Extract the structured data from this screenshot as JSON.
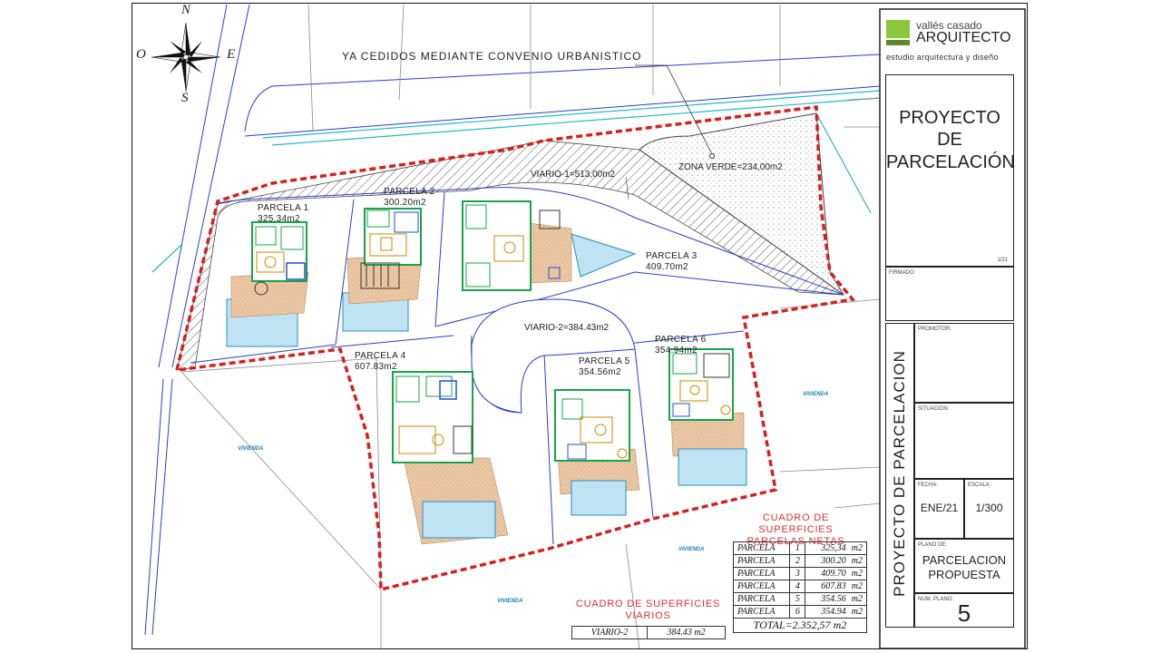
{
  "compass": {
    "n": "N",
    "s": "S",
    "e": "E",
    "o": "O"
  },
  "annotation": "YA CEDIDOS MEDIANTE CONVENIO URBANISTICO",
  "zones": {
    "viario1": "VIARIO-1=513,00m2",
    "viario2": "VIARIO-2=384.43m2",
    "zona_verde": "ZONA VERDE=234,00m2"
  },
  "parcelas": [
    {
      "name": "PARCELA 1",
      "area": "325.34m2"
    },
    {
      "name": "PARCELA 2",
      "area": "300.20m2"
    },
    {
      "name": "PARCELA 3",
      "area": "409.70m2"
    },
    {
      "name": "PARCELA 4",
      "area": "607.83m2"
    },
    {
      "name": "PARCELA 5",
      "area": "354.56m2"
    },
    {
      "name": "PARCELA 6",
      "area": "354.94m2"
    }
  ],
  "vivienda_label": "VIVIENDA",
  "title_block": {
    "brand_line1": "vallés casado",
    "brand_line2": "ARQUITECTO",
    "brand_line3": "estudio arquitectura y diseño",
    "project_title_1": "PROYECTO",
    "project_title_2": "DE",
    "project_title_3": "PARCELACIÓN",
    "date_code": "1/21",
    "firmado_label": "FIRMADO:",
    "promotor_label": "PROMOTOR:",
    "situacion_label": "SITUACION:",
    "fecha_label": "FECHA:",
    "fecha_value": "ENE/21",
    "escala_label": "ESCALA:",
    "escala_value": "1/300",
    "plano_de_label": "PLANO DE:",
    "plano_de_value_1": "PARCELACION",
    "plano_de_value_2": "PROPUESTA",
    "num_plano_label": "NUM. PLANO:",
    "num_plano_value": "5",
    "vertical_title": "PROYECTO DE PARCELACION"
  },
  "cuadro_parcelas": {
    "title_1": "CUADRO DE SUPERFICIES",
    "title_2": "PARCELAS NETAS",
    "rows": [
      {
        "label": "PARCELA",
        "num": "1",
        "value": "325,34",
        "unit": "m2"
      },
      {
        "label": "PARCELA",
        "num": "2",
        "value": "300.20",
        "unit": "m2"
      },
      {
        "label": "PARCELA",
        "num": "3",
        "value": "409.70",
        "unit": "m2"
      },
      {
        "label": "PARCELA",
        "num": "4",
        "value": "607.83",
        "unit": "m2"
      },
      {
        "label": "PARCELA",
        "num": "5",
        "value": "354.56",
        "unit": "m2"
      },
      {
        "label": "PARCELA",
        "num": "6",
        "value": "354.94",
        "unit": "m2"
      }
    ],
    "total": "TOTAL=2.352,57 m2"
  },
  "cuadro_viarios": {
    "title_1": "CUADRO DE SUPERFICIES",
    "title_2": "VIARIOS",
    "row_label": "VIARIO-2",
    "row_value": "384.43 m2"
  },
  "colors": {
    "boundary": "#d42020",
    "hatch": "#555555",
    "pool": "#bfe3f3",
    "terrace": "#e9c6a5",
    "house_green": "#16a34a",
    "brand_green": "#8cc63f"
  }
}
